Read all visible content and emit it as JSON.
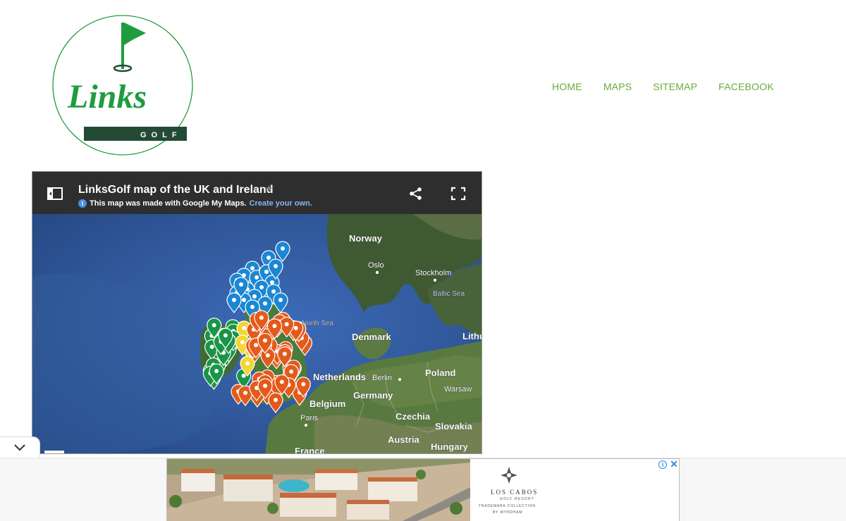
{
  "logo": {
    "word": "Links",
    "sub": "GOLF",
    "colors": {
      "green": "#1e9c3e",
      "dark": "#234a34"
    }
  },
  "nav": {
    "items": [
      {
        "label": "HOME"
      },
      {
        "label": "MAPS"
      },
      {
        "label": "SITEMAP"
      },
      {
        "label": "FACEBOOK"
      }
    ],
    "color": "#6aab3a"
  },
  "map": {
    "title": "LinksGolf map of the UK and Ireland",
    "subtitle": "This map was made with Google My Maps.",
    "subtitle_link": "Create your own.",
    "labels": {
      "norway": "Norway",
      "oslo": "Oslo",
      "stockholm": "Stockholm",
      "baltic": "Baltic Sea",
      "north_sea": "North Sea",
      "denmark": "Denmark",
      "lithuania": "Lithu",
      "netherlands": "Netherlands",
      "berlin": "Berlin",
      "poland": "Poland",
      "warsaw": "Warsaw",
      "germany": "Germany",
      "belgium": "Belgium",
      "paris": "Paris",
      "czechia": "Czechia",
      "slovakia": "Slovakia",
      "austria": "Austria",
      "hungary": "Hungary",
      "france": "France"
    },
    "marker_colors": {
      "scotland": "#1b87d4",
      "ireland": "#1a9446",
      "wales": "#f3d630",
      "england": "#e35a1b"
    },
    "icons": {
      "panel": "side-panel-icon",
      "share": "share-icon",
      "fullscreen": "fullscreen-icon",
      "star": "star-icon",
      "info": "info-icon"
    }
  },
  "ad": {
    "brand_name": "LOS CABOS",
    "brand_sub": "GOLF RESORT",
    "brand_tm": "TRADEMARK COLLECTION",
    "brand_wyn": "BY WYNDHAM",
    "info_icon": "i",
    "close_icon": "✕"
  },
  "collapse": {
    "icon": "chevron-down-icon"
  }
}
